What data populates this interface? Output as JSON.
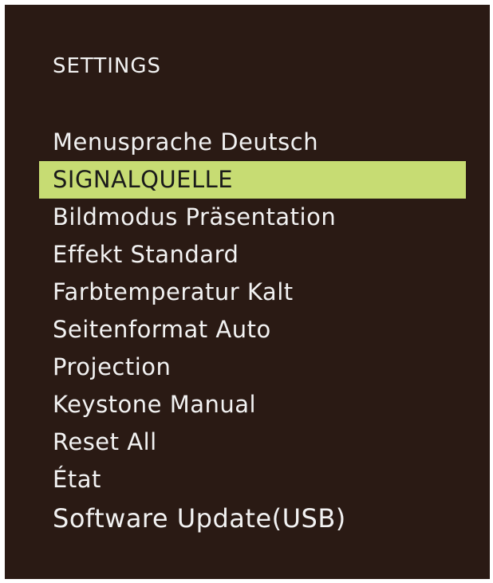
{
  "menu": {
    "title": "SETTINGS",
    "items": [
      {
        "label": "Menusprache  Deutsch",
        "selected": false
      },
      {
        "label": "SIGNALQUELLE",
        "selected": true
      },
      {
        "label": "Bildmodus Präsentation",
        "selected": false
      },
      {
        "label": "Effekt Standard",
        "selected": false
      },
      {
        "label": "Farbtemperatur Kalt",
        "selected": false
      },
      {
        "label": "Seitenformat Auto",
        "selected": false
      },
      {
        "label": "Projection",
        "selected": false
      },
      {
        "label": "Keystone Manual",
        "selected": false
      },
      {
        "label": "Reset All",
        "selected": false
      },
      {
        "label": "État",
        "selected": false
      },
      {
        "label": "Software Update(USB)",
        "selected": false
      }
    ]
  },
  "colors": {
    "background": "#2a1a14",
    "text": "#f2f2f2",
    "highlight": "#c7dc73",
    "highlight_text": "#1a1a1a"
  }
}
